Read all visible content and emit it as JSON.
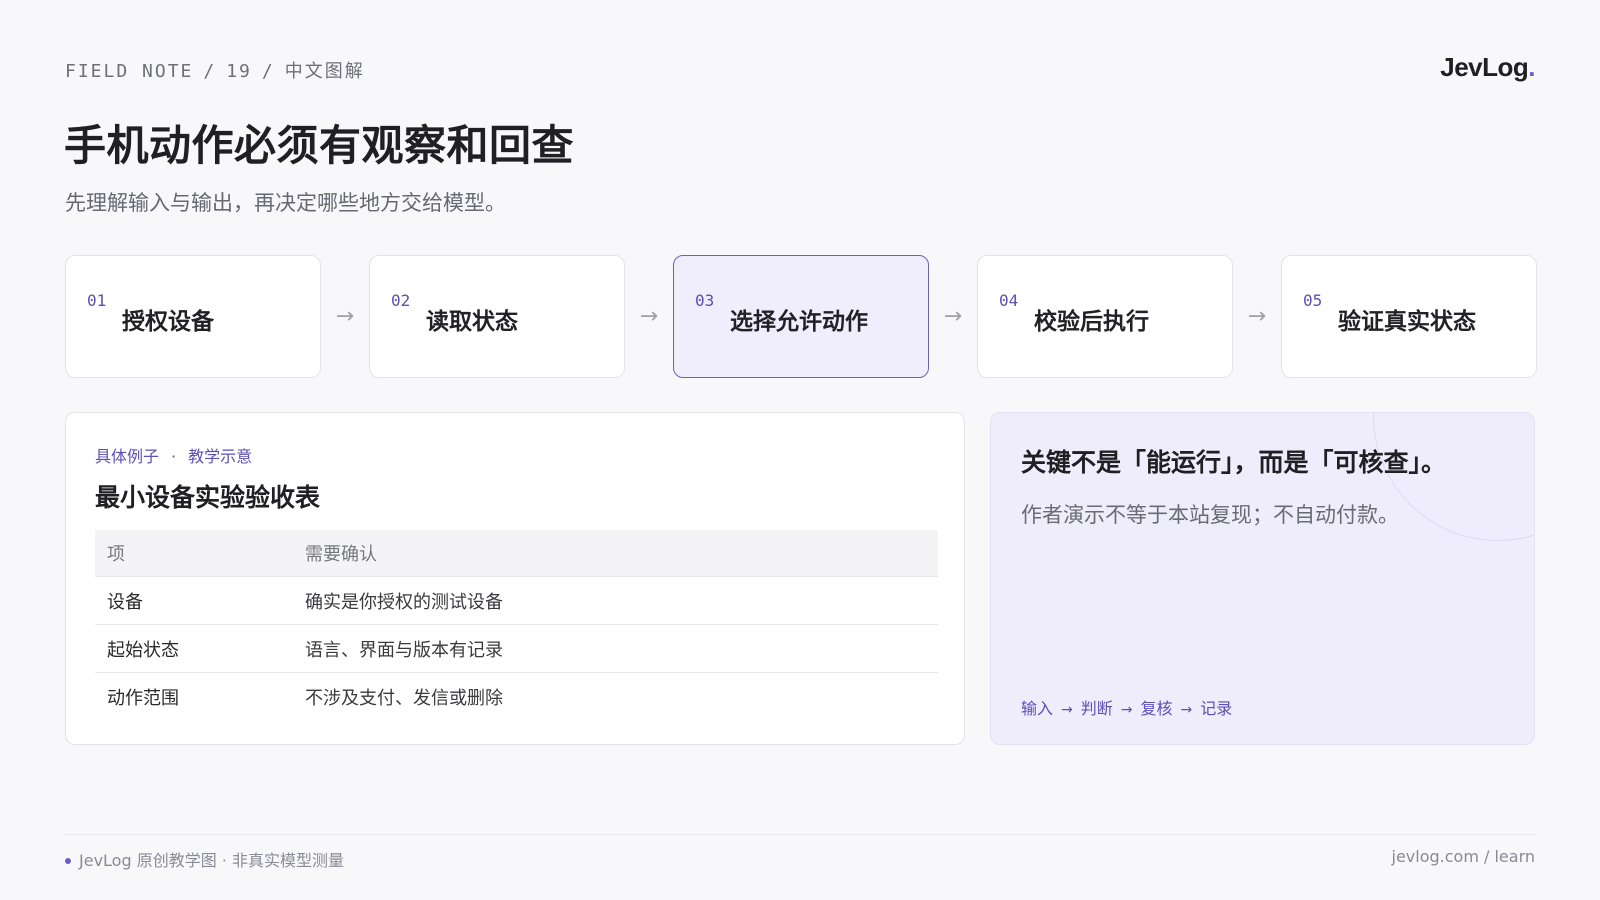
{
  "header": {
    "kicker_series": "FIELD NOTE",
    "kicker_number": "19",
    "kicker_topic": "中文图解",
    "brand": "JevLog",
    "brand_dot": ".",
    "title": "手机动作必须有观察和回查",
    "subtitle": "先理解输入与输出，再决定哪些地方交给模型。"
  },
  "steps": [
    {
      "num": "01",
      "label": "授权设备"
    },
    {
      "num": "02",
      "label": "读取状态"
    },
    {
      "num": "03",
      "label": "选择允许动作"
    },
    {
      "num": "04",
      "label": "校验后执行"
    },
    {
      "num": "05",
      "label": "验证真实状态"
    }
  ],
  "active_step": "03",
  "step_arrow": "→",
  "example_card": {
    "tag_left": "具体例子",
    "tag_sep": "·",
    "tag_right": "教学示意",
    "title": "最小设备实验验收表",
    "columns": [
      "项",
      "需要确认"
    ],
    "rows": [
      [
        "设备",
        "确实是你授权的测试设备"
      ],
      [
        "起始状态",
        "语言、界面与版本有记录"
      ],
      [
        "动作范围",
        "不涉及支付、发信或删除"
      ]
    ]
  },
  "note_card": {
    "title": "关键不是「能运行」，而是「可核查」。",
    "text": "作者演示不等于本站复现；不自动付款。",
    "flow": [
      "输入",
      "判断",
      "复核",
      "记录"
    ],
    "flow_arrow": "→"
  },
  "footer": {
    "left": "JevLog 原创教学图 · 非真实模型测量",
    "right": "jevlog.com / learn"
  },
  "colors": {
    "accent": "#6b5fc7",
    "background": "#f8f8fb",
    "active_step_bg": "#f0eefc",
    "note_bg": "#efedfb"
  }
}
